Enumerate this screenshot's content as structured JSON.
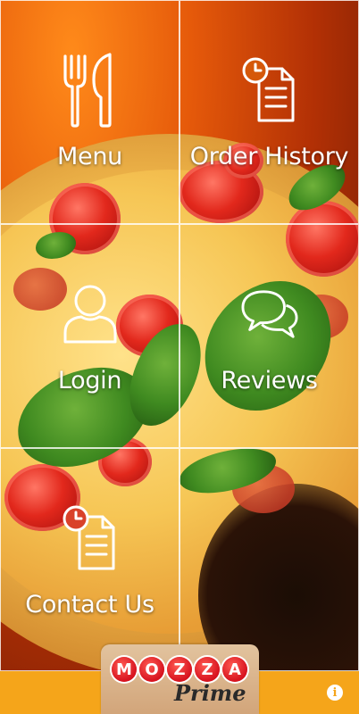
{
  "tiles": [
    {
      "label": "Menu",
      "icon": "fork-knife-icon"
    },
    {
      "label": "Order History",
      "icon": "clock-document-icon"
    },
    {
      "label": "Login",
      "icon": "user-icon"
    },
    {
      "label": "Reviews",
      "icon": "chat-bubbles-icon"
    },
    {
      "label": "Contact Us",
      "icon": "clock-document-icon"
    }
  ],
  "logo": {
    "letters": [
      "M",
      "O",
      "Z",
      "Z",
      "A"
    ],
    "subtitle": "Prime"
  },
  "info_button": {
    "glyph": "i",
    "icon": "info-icon"
  },
  "colors": {
    "bottom_bar": "#f5a51a",
    "logo_letter": "#d7121f",
    "tile_text": "#ffffff"
  }
}
